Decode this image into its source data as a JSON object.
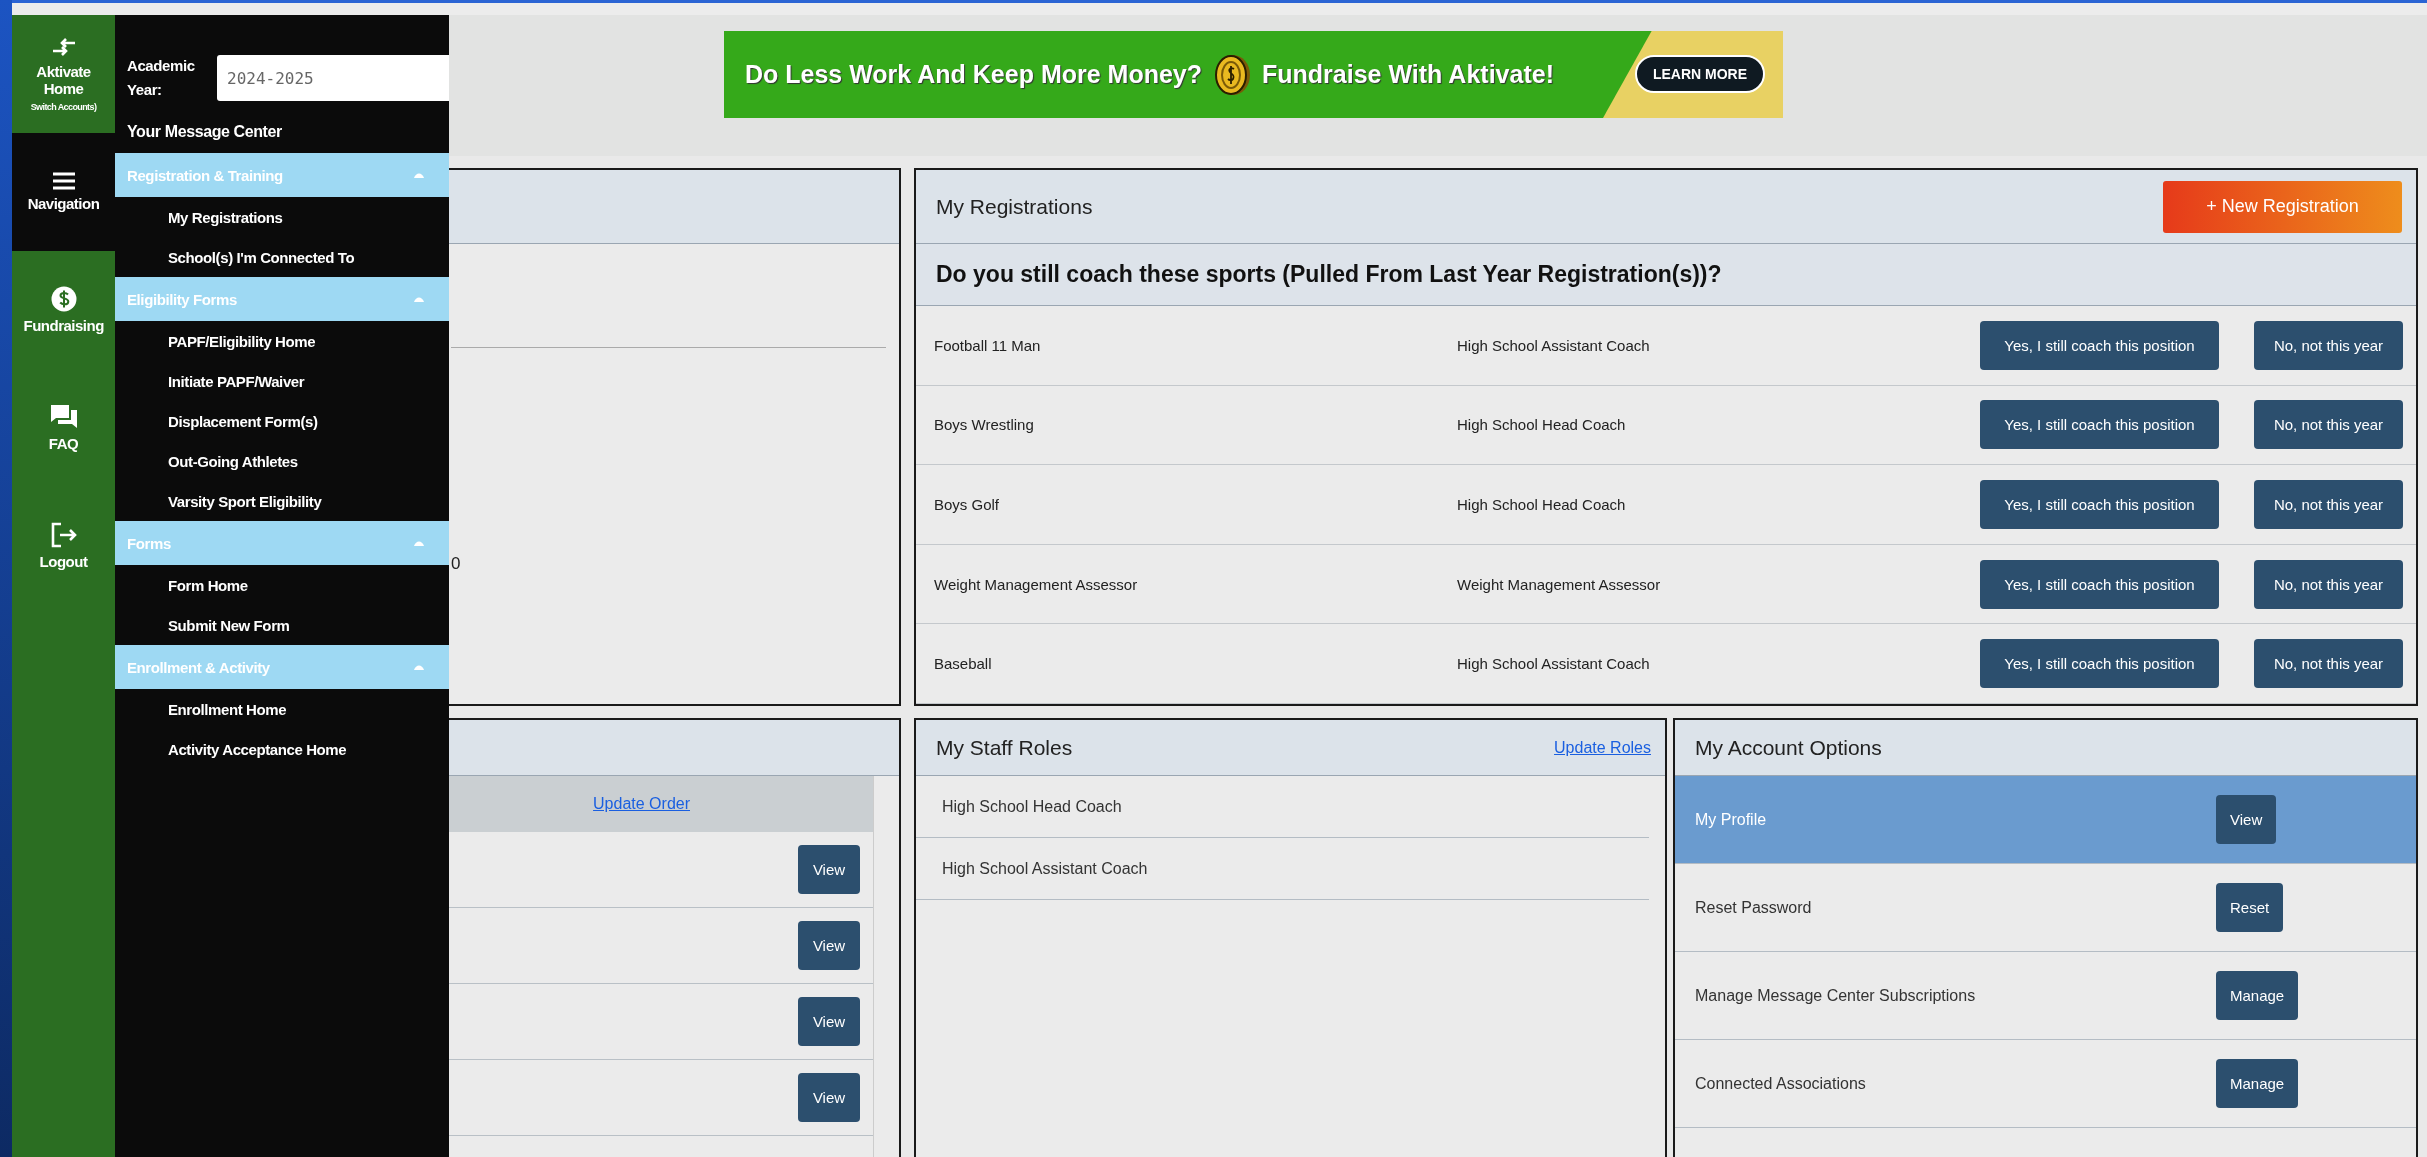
{
  "sidebar": {
    "items": [
      {
        "kind": "switch",
        "label": "Aktivate Home",
        "sublabel": "Switch Accounts)",
        "selected": false
      },
      {
        "kind": "menu",
        "label": "Navigation",
        "selected": true
      },
      {
        "kind": "fundraising",
        "label": "Fundraising",
        "selected": false
      },
      {
        "kind": "faq",
        "label": "FAQ",
        "selected": false
      },
      {
        "kind": "logout",
        "label": "Logout",
        "selected": false
      }
    ]
  },
  "nav_menu": {
    "academic_year": {
      "label": "Academic Year:",
      "value": "2024-2025"
    },
    "message_center": "Your Message Center",
    "sections": [
      {
        "title": "Registration & Training",
        "expanded": true,
        "items": [
          "My Registrations",
          "School(s) I'm Connected To"
        ]
      },
      {
        "title": "Eligibility Forms",
        "expanded": true,
        "items": [
          "PAPF/Eligibility Home",
          "Initiate PAPF/Waiver",
          "Displacement Form(s)",
          "Out-Going Athletes",
          "Varsity Sport Eligibility"
        ]
      },
      {
        "title": "Forms",
        "expanded": true,
        "items": [
          "Form Home",
          "Submit New Form"
        ]
      },
      {
        "title": "Enrollment & Activity",
        "expanded": true,
        "items": [
          "Enrollment Home",
          "Activity Acceptance Home"
        ]
      }
    ]
  },
  "banner": {
    "text_1": "Do Less Work And Keep More Money?",
    "text_2": "Fundraise With Aktivate!",
    "button": "LEARN MORE"
  },
  "hidden_panel": {
    "text_fragment": "0"
  },
  "order_panel": {
    "link": "Update Order",
    "buttons": [
      "View",
      "View",
      "View",
      "View"
    ]
  },
  "registrations": {
    "title": "My Registrations",
    "new_button": "+ New Registration",
    "question": "Do you still coach these sports (Pulled From Last Year Registration(s))?",
    "rows": [
      {
        "sport": "Football 11 Man",
        "role": "High School Assistant Coach",
        "yes": "Yes, I still coach this position",
        "no": "No, not this year"
      },
      {
        "sport": "Boys Wrestling",
        "role": "High School Head Coach",
        "yes": "Yes, I still coach this position",
        "no": "No, not this year"
      },
      {
        "sport": "Boys Golf",
        "role": "High School Head Coach",
        "yes": "Yes, I still coach this position",
        "no": "No, not this year"
      },
      {
        "sport": "Weight Management Assessor",
        "role": "Weight Management Assessor",
        "yes": "Yes, I still coach this position",
        "no": "No, not this year"
      },
      {
        "sport": "Baseball",
        "role": "High School Assistant Coach",
        "yes": "Yes, I still coach this position",
        "no": "No, not this year"
      }
    ]
  },
  "staff_roles": {
    "title": "My Staff Roles",
    "link": "Update Roles",
    "roles": [
      "High School Head Coach",
      "High School Assistant Coach"
    ]
  },
  "account_options": {
    "title": "My Account Options",
    "rows": [
      {
        "label": "My Profile",
        "button": "View",
        "selected": true
      },
      {
        "label": "Reset Password",
        "button": "Reset",
        "selected": false
      },
      {
        "label": "Manage Message Center Subscriptions",
        "button": "Manage",
        "selected": false
      },
      {
        "label": "Connected Associations",
        "button": "Manage",
        "selected": false
      }
    ]
  }
}
